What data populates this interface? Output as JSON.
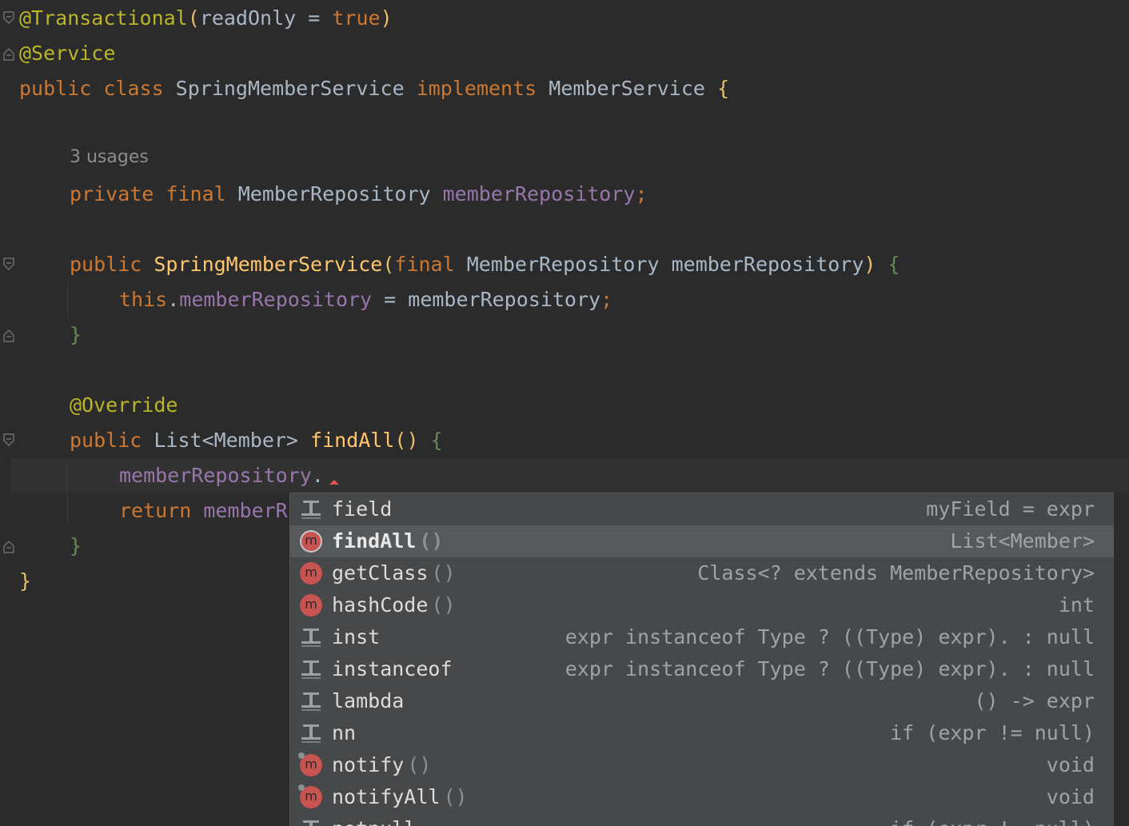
{
  "editor": {
    "hint_usages": "3 usages",
    "lines": {
      "l1": {
        "ann": "@Transactional",
        "open": "(",
        "param": "readOnly",
        "eq": " = ",
        "val": "true",
        "close": ")"
      },
      "l2": {
        "ann": "@Service"
      },
      "l3": {
        "kw1": "public ",
        "kw2": "class ",
        "cls": "SpringMemberService ",
        "kw3": "implements ",
        "iface": "MemberService ",
        "brace": "{"
      },
      "l4": {
        "kw1": "private ",
        "kw2": "final ",
        "type": "MemberRepository ",
        "field": "memberRepository",
        "semi": ";"
      },
      "l5": {
        "kw1": "public ",
        "ctor": "SpringMemberService",
        "open": "(",
        "kw2": "final ",
        "type": "MemberRepository ",
        "param": "memberRepository",
        "close": ")",
        "brace": " {"
      },
      "l6": {
        "kw": "this",
        "dot": ".",
        "field": "memberRepository",
        "eq": " = ",
        "param": "memberRepository",
        "semi": ";"
      },
      "l7": {
        "brace": "}"
      },
      "l8": {
        "ann": "@Override"
      },
      "l9": {
        "kw": "public ",
        "type": "List",
        "gen": "<Member> ",
        "fn": "findAll",
        "parens": "()",
        "brace": " {"
      },
      "l10": {
        "field": "memberRepository",
        "dot": "."
      },
      "l11": {
        "kw": "return ",
        "field": "memberR"
      },
      "l12": {
        "brace": "}"
      },
      "l13": {
        "brace": "}"
      }
    }
  },
  "completion": {
    "items": [
      {
        "name": "field",
        "parens": "",
        "tail": "myField = expr",
        "icon": "live-template-icon"
      },
      {
        "name": "findAll",
        "parens": "()",
        "tail": "List<Member>",
        "icon": "method-icon"
      },
      {
        "name": "getClass",
        "parens": "()",
        "tail": "Class<? extends MemberRepository>",
        "icon": "method-icon"
      },
      {
        "name": "hashCode",
        "parens": "()",
        "tail": "int",
        "icon": "method-icon"
      },
      {
        "name": "inst",
        "parens": "",
        "tail": "expr instanceof Type ? ((Type) expr). : null",
        "icon": "live-template-icon"
      },
      {
        "name": "instanceof",
        "parens": "",
        "tail": "expr instanceof Type ? ((Type) expr). : null",
        "icon": "live-template-icon"
      },
      {
        "name": "lambda",
        "parens": "",
        "tail": "() -> expr",
        "icon": "live-template-icon"
      },
      {
        "name": "nn",
        "parens": "",
        "tail": "if (expr != null)",
        "icon": "live-template-icon"
      },
      {
        "name": "notify",
        "parens": "()",
        "tail": "void",
        "icon": "method-icon"
      },
      {
        "name": "notifyAll",
        "parens": "()",
        "tail": "void",
        "icon": "method-icon"
      },
      {
        "name": "notnull",
        "parens": "",
        "tail": "if (expr != null)",
        "icon": "live-template-icon"
      }
    ],
    "colors": {
      "method": "#c75450",
      "template": "#9da0a3",
      "selected_bg": "#56595c"
    }
  }
}
